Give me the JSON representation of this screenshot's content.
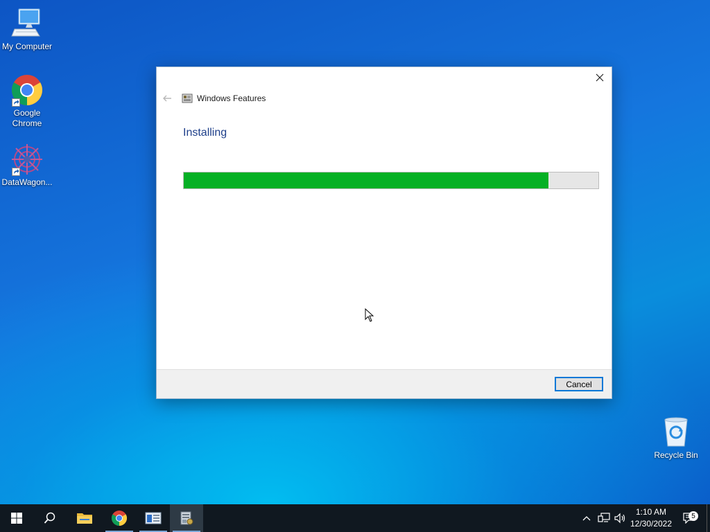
{
  "desktop": {
    "icons": [
      {
        "label": "My Computer"
      },
      {
        "label": "Google Chrome"
      },
      {
        "label": "DataWagon..."
      },
      {
        "label": "Recycle Bin"
      }
    ]
  },
  "dialog": {
    "title": "Windows Features",
    "heading": "Installing",
    "progress_fraction": 0.88,
    "progress_color": "#06b025",
    "cancel_label": "Cancel"
  },
  "taskbar": {
    "apps": [
      "start-icon",
      "search-icon",
      "file-explorer-icon",
      "chrome-icon",
      "server-manager-icon",
      "windows-features-icon"
    ],
    "time": "1:10 AM",
    "date": "12/30/2022",
    "notification_count": "5"
  }
}
